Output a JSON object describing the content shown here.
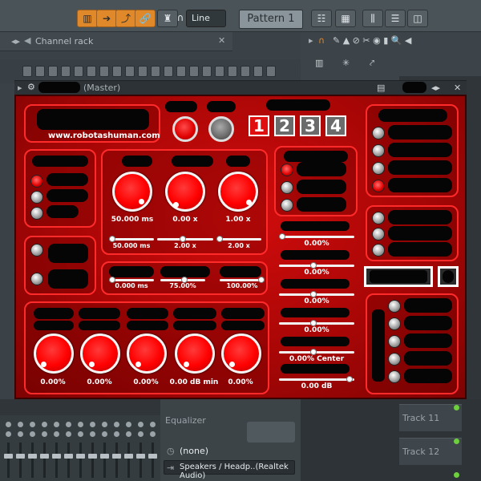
{
  "toolbar": {
    "line_mode": "Line",
    "pattern": "Pattern 1"
  },
  "channel_rack": {
    "title": "Channel rack"
  },
  "window": {
    "title": "(Master)"
  },
  "plugin": {
    "url": "www.robotashuman.com",
    "page_numbers": [
      "1",
      "2",
      "3",
      "4"
    ],
    "active_page": "1",
    "knob_values_top": [
      "50.000 ms",
      "0.00 x",
      "1.00 x"
    ],
    "slider_values_top": [
      "50.000 ms",
      "2.00 x",
      "2.00 x"
    ],
    "slider_values_mid": [
      "0.000 ms",
      "75.00%",
      "100.00%"
    ],
    "knob_values_bottom": [
      "0.00%",
      "0.00%",
      "0.00%",
      "0.00 dB min",
      "0.00%"
    ],
    "right_slider_values": [
      "0.00%",
      "0.00%",
      "0.00%",
      "0.00%",
      "0.00% Center",
      "0.00 dB"
    ]
  },
  "mixer": {
    "eq_label": "Equalizer",
    "preset": "(none)",
    "output": "Speakers / Headp..(Realtek Audio)"
  },
  "playlist": {
    "tracks": [
      "Track 11",
      "Track 12"
    ]
  },
  "colors": {
    "accent_orange": "#e0892b",
    "plugin_red": "#d10c0c",
    "panel_border": "#ff2b2b"
  }
}
